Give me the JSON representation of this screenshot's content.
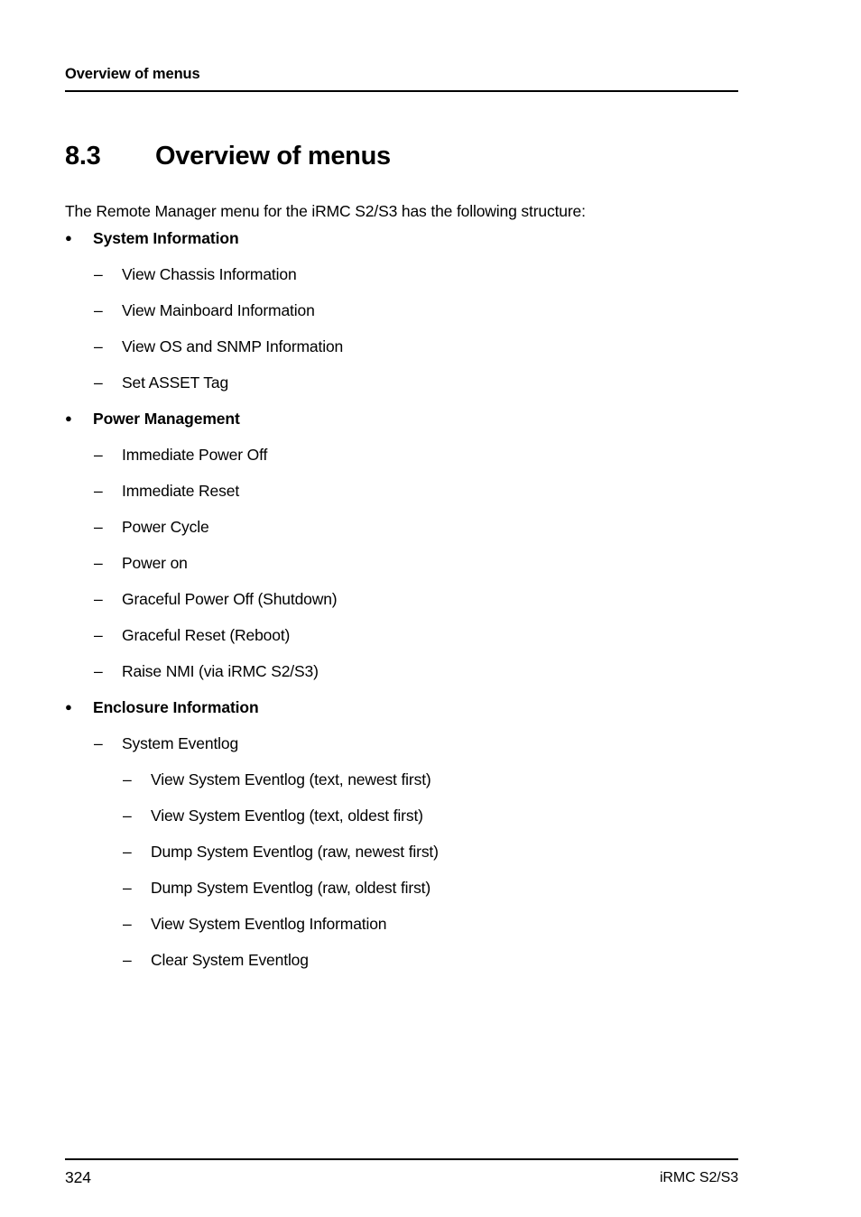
{
  "header": {
    "running_title": "Overview of menus"
  },
  "section": {
    "number": "8.3",
    "title": "Overview of menus"
  },
  "intro": {
    "text": "The Remote Manager menu for the iRMC S2/S3 has the following structure:"
  },
  "menu": [
    {
      "level": 1,
      "marker": "●",
      "label": "System Information"
    },
    {
      "level": 2,
      "marker": "–",
      "label": "View Chassis Information"
    },
    {
      "level": 2,
      "marker": "–",
      "label": "View Mainboard Information"
    },
    {
      "level": 2,
      "marker": "–",
      "label": "View OS and SNMP Information"
    },
    {
      "level": 2,
      "marker": "–",
      "label": "Set ASSET Tag"
    },
    {
      "level": 1,
      "marker": "●",
      "label": "Power Management"
    },
    {
      "level": 2,
      "marker": "–",
      "label": "Immediate Power Off"
    },
    {
      "level": 2,
      "marker": "–",
      "label": "Immediate Reset"
    },
    {
      "level": 2,
      "marker": "–",
      "label": "Power Cycle"
    },
    {
      "level": 2,
      "marker": "–",
      "label": "Power on"
    },
    {
      "level": 2,
      "marker": "–",
      "label": "Graceful Power Off (Shutdown)"
    },
    {
      "level": 2,
      "marker": "–",
      "label": "Graceful Reset (Reboot)"
    },
    {
      "level": 2,
      "marker": "–",
      "label": "Raise NMI (via iRMC S2/S3)"
    },
    {
      "level": 1,
      "marker": "●",
      "label": "Enclosure Information"
    },
    {
      "level": 2,
      "marker": "–",
      "label": "System Eventlog"
    },
    {
      "level": 3,
      "marker": "–",
      "label": "View System Eventlog (text, newest first)"
    },
    {
      "level": 3,
      "marker": "–",
      "label": "View System Eventlog (text, oldest first)"
    },
    {
      "level": 3,
      "marker": "–",
      "label": "Dump System Eventlog (raw, newest first)"
    },
    {
      "level": 3,
      "marker": "–",
      "label": "Dump System Eventlog (raw, oldest first)"
    },
    {
      "level": 3,
      "marker": "–",
      "label": "View System Eventlog Information"
    },
    {
      "level": 3,
      "marker": "–",
      "label": "Clear System Eventlog"
    }
  ],
  "footer": {
    "page_number": "324",
    "product": "iRMC S2/S3"
  }
}
